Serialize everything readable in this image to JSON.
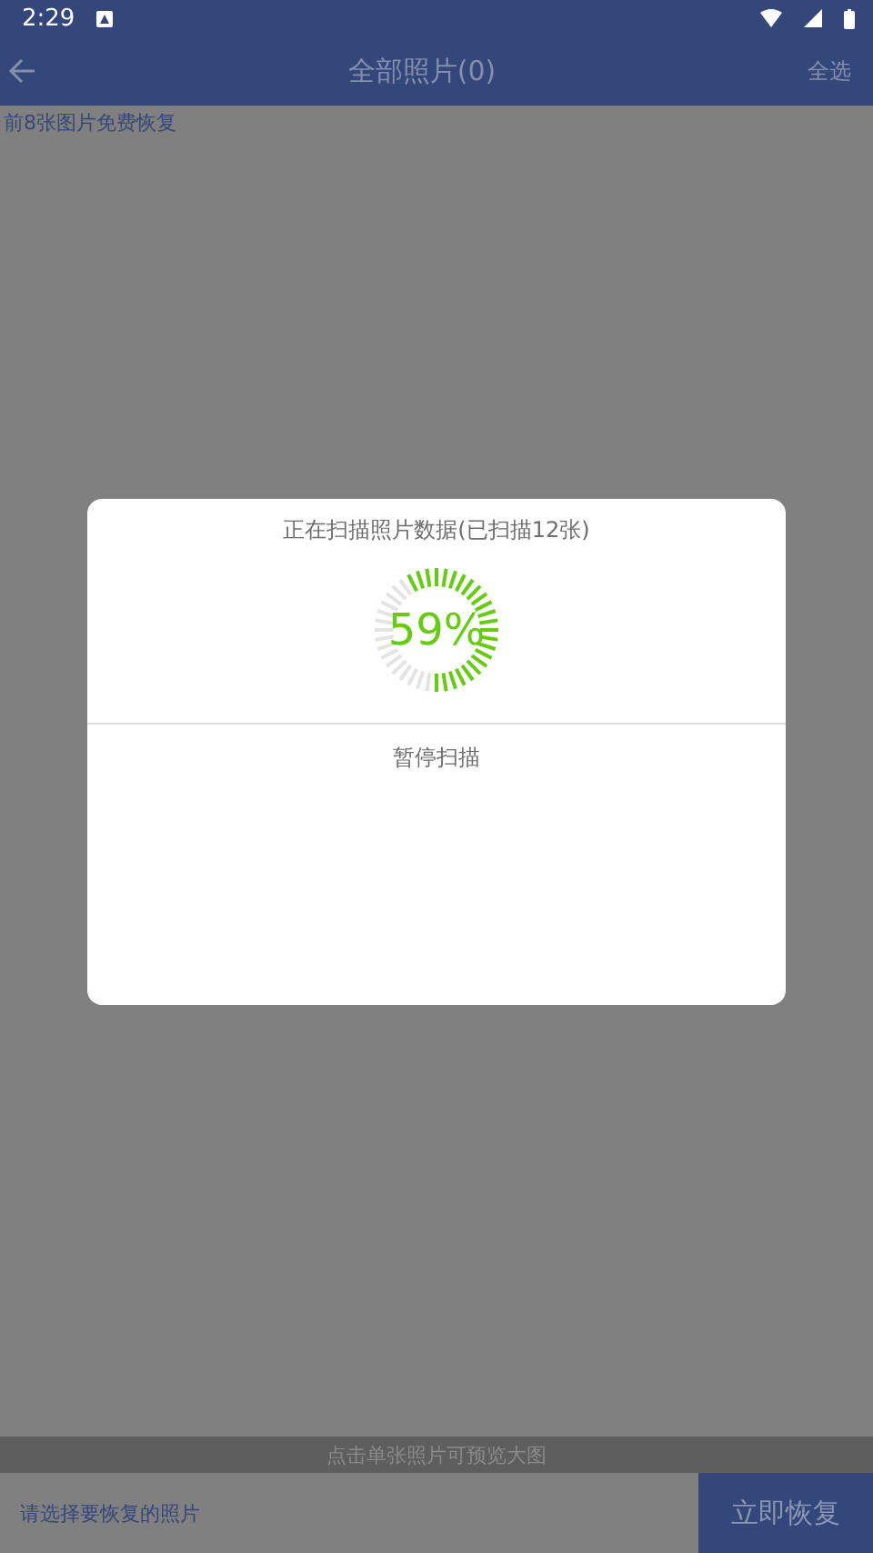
{
  "status_bar": {
    "time": "2:29"
  },
  "app_bar": {
    "title": "全部照片(0)",
    "action": "全选"
  },
  "notice": "前8张图片免费恢复",
  "dialog": {
    "message": "正在扫描照片数据(已扫描12张)",
    "progress_text": "59%",
    "level": 0.59,
    "button": "暂停扫描"
  },
  "hint_bar": "点击单张照片可预览大图",
  "bottom_bar": {
    "prompt": "请选择要恢复的照片",
    "button": "立即恢复"
  }
}
